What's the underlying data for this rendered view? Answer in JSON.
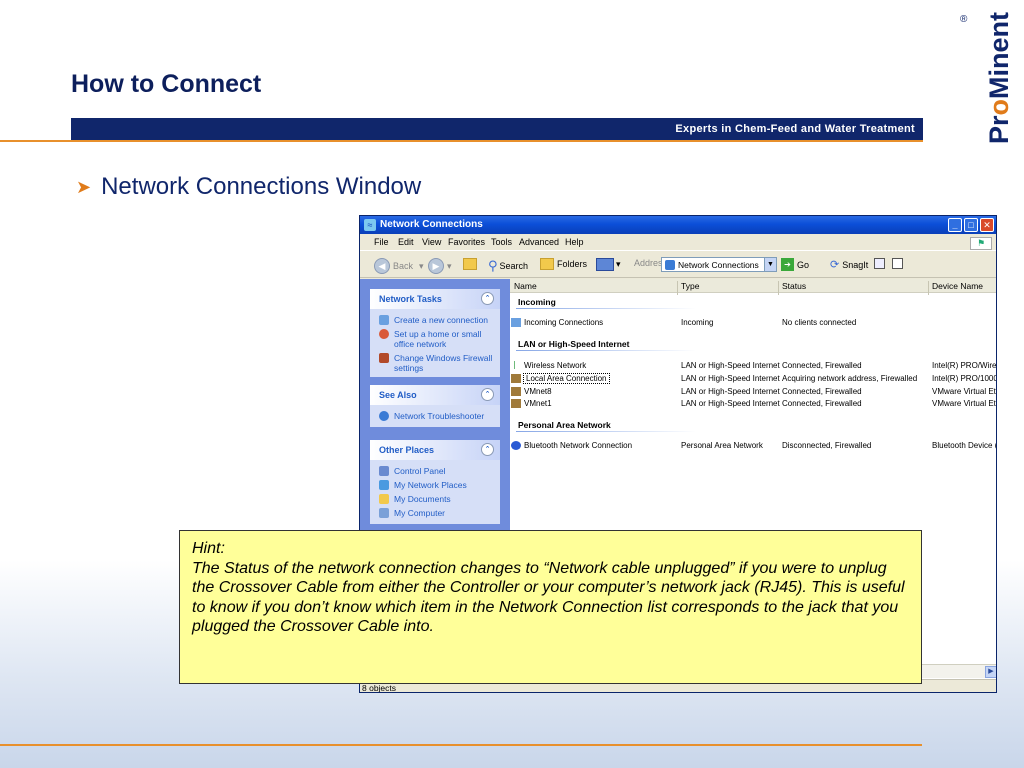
{
  "slide": {
    "title": "How to Connect",
    "tagline": "Experts in Chem-Feed and Water Treatment",
    "logo": {
      "name": "ProMinent",
      "part1": "Pr",
      "part2": "o",
      "part3": "Minent",
      "reg": "®"
    },
    "bullet": "Network Connections Window",
    "colors": {
      "navy": "#10266b",
      "orange": "#e07b1a",
      "hint_bg": "#ffff99"
    }
  },
  "window": {
    "title": "Network Connections",
    "menu": [
      "File",
      "Edit",
      "View",
      "Favorites",
      "Tools",
      "Advanced",
      "Help"
    ],
    "toolbar": {
      "back": "Back",
      "search": "Search",
      "folders": "Folders",
      "address_label": "Address",
      "address_value": "Network Connections",
      "go": "Go",
      "snagit": "SnagIt"
    },
    "task_pane": {
      "network_tasks": {
        "title": "Network Tasks",
        "items": [
          "Create a new connection",
          "Set up a home or small office network",
          "Change Windows Firewall settings"
        ]
      },
      "see_also": {
        "title": "See Also",
        "items": [
          "Network Troubleshooter"
        ]
      },
      "other_places": {
        "title": "Other Places",
        "items": [
          "Control Panel",
          "My Network Places",
          "My Documents",
          "My Computer"
        ]
      }
    },
    "list": {
      "columns": [
        "Name",
        "Type",
        "Status",
        "Device Name"
      ],
      "groups": [
        {
          "name": "Incoming",
          "rows": [
            {
              "name": "Incoming Connections",
              "type": "Incoming",
              "status": "No clients connected",
              "device": ""
            }
          ]
        },
        {
          "name": "LAN or High-Speed Internet",
          "rows": [
            {
              "name": "Wireless Network",
              "type": "LAN or High-Speed Internet",
              "status": "Connected, Firewalled",
              "device": "Intel(R) PRO/Wirel"
            },
            {
              "name": "Local Area Connection",
              "type": "LAN or High-Speed Internet",
              "status": "Acquiring network address, Firewalled",
              "device": "Intel(R) PRO/1000"
            },
            {
              "name": "VMnet8",
              "type": "LAN or High-Speed Internet",
              "status": "Connected, Firewalled",
              "device": "VMware Virtual Eth"
            },
            {
              "name": "VMnet1",
              "type": "LAN or High-Speed Internet",
              "status": "Connected, Firewalled",
              "device": "VMware Virtual Eth"
            }
          ]
        },
        {
          "name": "Personal Area Network",
          "rows": [
            {
              "name": "Bluetooth Network Connection",
              "type": "Personal Area Network",
              "status": "Disconnected, Firewalled",
              "device": "Bluetooth Device ("
            }
          ]
        }
      ]
    },
    "status_bar": "8 objects"
  },
  "hint": {
    "label": "Hint:",
    "text": "The Status of the network connection changes to “Network cable unplugged” if you were to unplug the Crossover Cable from either the Controller or your computer’s network jack (RJ45). This is useful to know if you don’t know which item in the Network Connection list corresponds to the jack that you plugged the Crossover Cable into."
  }
}
